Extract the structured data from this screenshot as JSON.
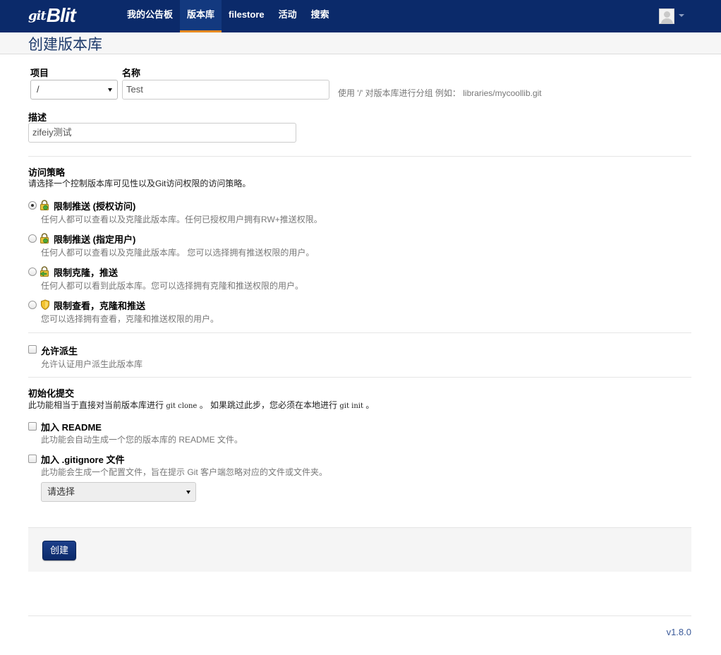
{
  "navbar": {
    "brand_prefix": "git",
    "brand_name": "Blit",
    "items": [
      {
        "label": "我的公告板",
        "active": false
      },
      {
        "label": "版本库",
        "active": true
      },
      {
        "label": "filestore",
        "active": false
      },
      {
        "label": "活动",
        "active": false
      },
      {
        "label": "搜索",
        "active": false
      }
    ]
  },
  "page": {
    "title": "创建版本库"
  },
  "form": {
    "project_label": "项目",
    "project_value": "/",
    "name_label": "名称",
    "name_value": "Test",
    "name_help": "使用 '/' 对版本库进行分组 例如： libraries/mycoollib.git",
    "description_label": "描述",
    "description_value": "zifeiy测试",
    "access_title": "访问策略",
    "access_subtitle": "请选择一个控制版本库可见性以及Git访问权限的访问策略。",
    "access_options": [
      {
        "label": "限制推送 (授权访问)",
        "desc": "任何人都可以查看以及克隆此版本库。任何已授权用户拥有RW+推送权限。",
        "checked": true,
        "icon": "lock-icon"
      },
      {
        "label": "限制推送 (指定用户)",
        "desc": "任何人都可以查看以及克隆此版本库。 您可以选择拥有推送权限的用户。",
        "checked": false,
        "icon": "lock-icon"
      },
      {
        "label": "限制克隆，推送",
        "desc": "任何人都可以看到此版本库。您可以选择拥有克隆和推送权限的用户。",
        "checked": false,
        "icon": "lock-icon"
      },
      {
        "label": "限制查看，克隆和推送",
        "desc": "您可以选择拥有查看，克隆和推送权限的用户。",
        "checked": false,
        "icon": "shield-icon"
      }
    ],
    "fork_label": "允许派生",
    "fork_desc": "允许认证用户派生此版本库",
    "init_title": "初始化提交",
    "init_subtitle_1": "此功能相当于直接对当前版本库进行",
    "init_code_1": "git clone",
    "init_subtitle_2": "。 如果跳过此步，您必须在本地进行",
    "init_code_2": "git init",
    "init_subtitle_3": "。",
    "readme_label": "加入 README",
    "readme_desc": "此功能会自动生成一个您的版本库的 README 文件。",
    "gitignore_label": "加入 .gitignore 文件",
    "gitignore_desc": "此功能会生成一个配置文件，旨在提示 Git 客户端忽略对应的文件或文件夹。",
    "gitignore_select": "请选择",
    "create_button": "创建"
  },
  "footer": {
    "version": "v1.8.0"
  },
  "colors": {
    "navbar": "#0b2a6a",
    "accent": "#e68a21",
    "title": "#1d3a6b"
  }
}
